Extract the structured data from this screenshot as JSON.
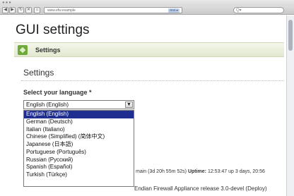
{
  "browser": {
    "url": "www.efw.example",
    "rss_label": "RSS ▾",
    "search_placeholder": "Q▾"
  },
  "page": {
    "title": "GUI settings",
    "section_label": "Settings",
    "settings_heading": "Settings"
  },
  "language": {
    "label": "Select your language *",
    "selected": "English (English)",
    "options": [
      "English (English)",
      "German (Deutsch)",
      "Italian (Italiano)",
      "Chinese (Simplified) (简体中文)",
      "Japanese (日本語)",
      "Portuguese (Português)",
      "Russian (Русский)",
      "Spanish (Español)",
      "Turkish (Türkçe)"
    ]
  },
  "footer": {
    "status_prefix": "main (3d 20h 55m 52s)",
    "uptime_label": "Uptime:",
    "uptime_value": "12:53:47 up 3 days, 20:56",
    "release": "Endian Firewall Appliance release 3.0-devel (Deploy)"
  },
  "colors": {
    "selected_option": "#1f2e8f",
    "section_icon": "#6fa83b"
  }
}
